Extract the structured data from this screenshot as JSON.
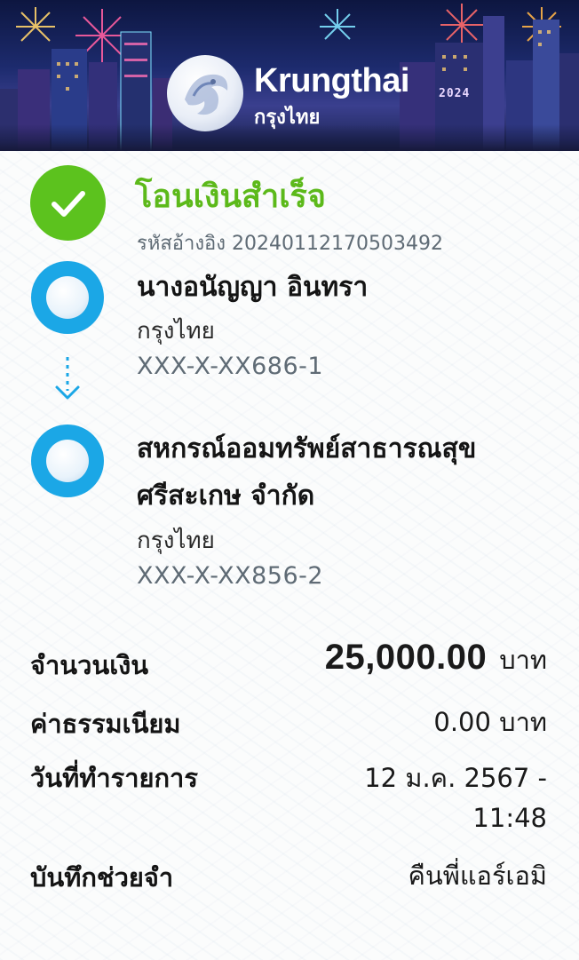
{
  "header": {
    "brand_en": "Krungthai",
    "brand_th": "กรุงไทย",
    "year_badge": "2024"
  },
  "status": {
    "title": "โอนเงินสำเร็จ",
    "reference_label": "รหัสอ้างอิง",
    "reference_number": "20240112170503492"
  },
  "sender": {
    "name": "นางอนัญญา อินทรา",
    "bank": "กรุงไทย",
    "account": "XXX-X-XX686-1"
  },
  "receiver": {
    "name_line1": "สหกรณ์ออมทรัพย์สาธารณสุข",
    "name_line2": "ศรีสะเกษ จำกัด",
    "bank": "กรุงไทย",
    "account": "XXX-X-XX856-2"
  },
  "details": {
    "amount_label": "จำนวนเงิน",
    "amount_value": "25,000.00",
    "amount_unit": "บาท",
    "fee_label": "ค่าธรรมเนียม",
    "fee_value": "0.00 บาท",
    "date_label": "วันที่ทำรายการ",
    "date_value": "12 ม.ค. 2567 -",
    "time_value": "11:48",
    "memo_label": "บันทึกช่วยจำ",
    "memo_value": "คืนพี่แอร์เอมิ"
  },
  "colors": {
    "success_green": "#5cc21e",
    "bank_blue": "#1ba7e6",
    "muted_text": "#5f6b75"
  }
}
